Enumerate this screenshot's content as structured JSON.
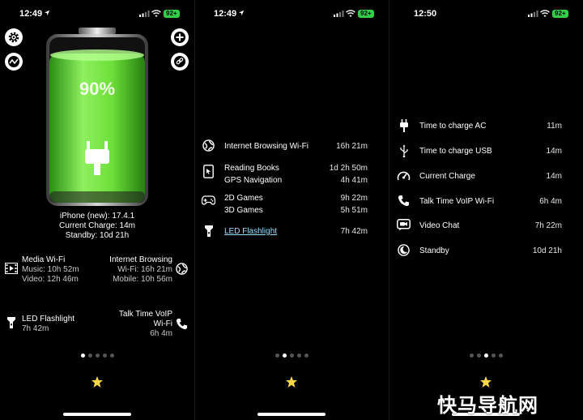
{
  "screens": [
    {
      "status": {
        "time": "12:49",
        "battery": "92+"
      },
      "battery_percent": "90%",
      "device": {
        "model_label": "iPhone (new):",
        "model_value": "17.4.1",
        "charge_label": "Current Charge:",
        "charge_value": "14m",
        "standby_label": "Standby:",
        "standby_value": "10d 21h"
      },
      "items": [
        {
          "title": "Media Wi-Fi",
          "lines": [
            "Music: 10h 52m",
            "Video: 12h 46m"
          ],
          "icon": "film-icon"
        },
        {
          "title": "Internet Browsing",
          "lines": [
            "Wi-Fi: 16h 21m",
            "Mobile: 10h 56m"
          ],
          "icon": "globe-icon"
        },
        {
          "title": "LED Flashlight",
          "lines": [
            "7h 42m"
          ],
          "icon": "flashlight-icon"
        },
        {
          "title": "Talk Time VoIP",
          "title2": "Wi-Fi",
          "lines": [
            "6h 4m"
          ],
          "icon": "phone-icon"
        }
      ]
    },
    {
      "status": {
        "time": "12:49",
        "battery": "92+"
      },
      "rows": [
        {
          "label": "Internet Browsing Wi-Fi",
          "value": "16h 21m",
          "icon": "globe-icon"
        },
        {
          "label": "Reading Books",
          "value": "1d 2h 50m",
          "icon": "book-icon"
        },
        {
          "label": "GPS Navigation",
          "value": "4h 41m",
          "icon": ""
        },
        {
          "label": "2D Games",
          "value": "9h 22m",
          "icon": "gamepad-icon"
        },
        {
          "label": "3D Games",
          "value": "5h 51m",
          "icon": ""
        },
        {
          "label": "LED Flashlight",
          "value": "7h 42m",
          "icon": "flashlight-icon"
        }
      ]
    },
    {
      "status": {
        "time": "12:50",
        "battery": "92+"
      },
      "rows": [
        {
          "label": "Time to charge AC",
          "value": "11m",
          "icon": "plug-icon"
        },
        {
          "label": "Time to charge USB",
          "value": "14m",
          "icon": "usb-icon"
        },
        {
          "label": "Current Charge",
          "value": "14m",
          "icon": "gauge-icon"
        },
        {
          "label": "Talk Time VoIP Wi-Fi",
          "value": "6h 4m",
          "icon": "phone-icon"
        },
        {
          "label": "Video Chat",
          "value": "7h 22m",
          "icon": "video-chat-icon"
        },
        {
          "label": "Standby",
          "value": "10d 21h",
          "icon": "moon-icon"
        }
      ]
    }
  ],
  "pager": {
    "count": 5,
    "active": [
      1,
      2,
      3
    ]
  },
  "watermark": "快马导航网",
  "colors": {
    "battery_green": "#5fe02f",
    "status_green": "#33d04a",
    "accent": "#9fdfff"
  }
}
